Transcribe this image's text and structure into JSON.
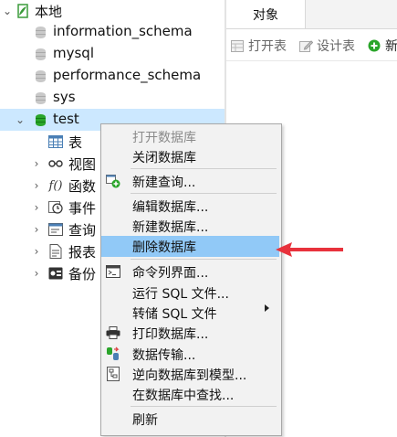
{
  "tree": {
    "root_label": "本地",
    "databases": [
      {
        "label": "information_schema"
      },
      {
        "label": "mysql"
      },
      {
        "label": "performance_schema"
      },
      {
        "label": "sys"
      },
      {
        "label": "test"
      }
    ],
    "test_children": [
      {
        "label": "表"
      },
      {
        "label": "视图"
      },
      {
        "label": "函数"
      },
      {
        "label": "事件"
      },
      {
        "label": "查询"
      },
      {
        "label": "报表"
      },
      {
        "label": "备份"
      }
    ]
  },
  "tab": {
    "label": "对象"
  },
  "toolbar": {
    "open_table": "打开表",
    "design_table": "设计表",
    "new_table": "新"
  },
  "context_menu": {
    "items": [
      {
        "label": "打开数据库"
      },
      {
        "label": "关闭数据库"
      },
      {
        "label": "新建查询..."
      },
      {
        "label": "编辑数据库..."
      },
      {
        "label": "新建数据库..."
      },
      {
        "label": "删除数据库"
      },
      {
        "label": "命令列界面..."
      },
      {
        "label": "运行 SQL 文件..."
      },
      {
        "label": "转储 SQL 文件"
      },
      {
        "label": "打印数据库..."
      },
      {
        "label": "数据传输..."
      },
      {
        "label": "逆向数据库到模型..."
      },
      {
        "label": "在数据库中查找..."
      },
      {
        "label": "刷新"
      }
    ]
  },
  "colors": {
    "selection": "#cce8ff",
    "menu_highlight": "#91c9f7",
    "arrow": "#e8323c",
    "db_active": "#2aa52a"
  }
}
